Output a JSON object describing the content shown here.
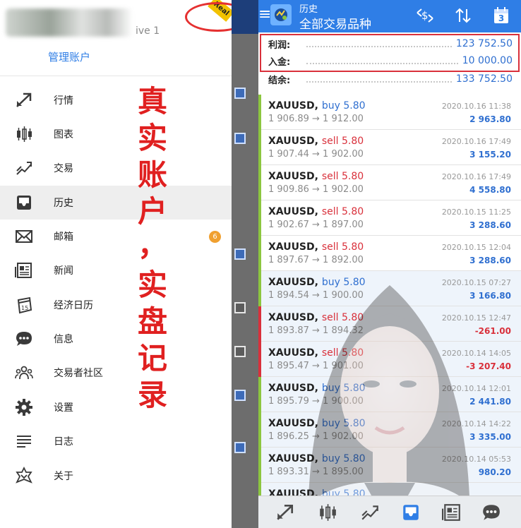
{
  "drawer": {
    "account_name": "",
    "account_status": "ive 1",
    "manage_accounts": "管理账户",
    "real_badge": "Real",
    "items": [
      {
        "label": "行情",
        "icon": "quotes-icon"
      },
      {
        "label": "图表",
        "icon": "candlestick-chart-icon"
      },
      {
        "label": "交易",
        "icon": "trade-icon"
      },
      {
        "label": "历史",
        "icon": "history-inbox-icon"
      },
      {
        "label": "邮箱",
        "icon": "mail-icon",
        "badge": "6"
      },
      {
        "label": "新闻",
        "icon": "news-icon"
      },
      {
        "label": "经济日历",
        "icon": "economic-calendar-icon"
      },
      {
        "label": "信息",
        "icon": "chat-bubble-icon"
      },
      {
        "label": "交易者社区",
        "icon": "community-icon"
      },
      {
        "label": "设置",
        "icon": "gear-icon"
      },
      {
        "label": "日志",
        "icon": "journal-icon"
      },
      {
        "label": "关于",
        "icon": "about-icon"
      }
    ],
    "active_index": 3,
    "overlay_text": [
      "真",
      "实",
      "账",
      "户",
      "，",
      "实",
      "盘",
      "记",
      "录"
    ]
  },
  "appbar": {
    "title": "历史",
    "subtitle": "全部交易品种",
    "menu_icon": "hamburger-icon",
    "actions": [
      "currency-exchange-icon",
      "sort-icon",
      "calendar-icon"
    ],
    "calendar_day": "3"
  },
  "summary": {
    "profit_label": "利润:",
    "profit_value": "123 752.50",
    "deposit_label": "入金:",
    "deposit_value": "10 000.00",
    "balance_label": "结余:",
    "balance_value": "133 752.50"
  },
  "deals": [
    {
      "symbol": "XAUUSD,",
      "side": "buy 5.80",
      "prices": "1 906.89 → 1 912.00",
      "time": "2020.10.16 11:38",
      "profit": "2 963.80"
    },
    {
      "symbol": "XAUUSD,",
      "side": "sell 5.80",
      "prices": "1 907.44 → 1 902.00",
      "time": "2020.10.16 17:49",
      "profit": "3 155.20"
    },
    {
      "symbol": "XAUUSD,",
      "side": "sell 5.80",
      "prices": "1 909.86 → 1 902.00",
      "time": "2020.10.16 17:49",
      "profit": "4 558.80"
    },
    {
      "symbol": "XAUUSD,",
      "side": "sell 5.80",
      "prices": "1 902.67 → 1 897.00",
      "time": "2020.10.15 11:25",
      "profit": "3 288.60"
    },
    {
      "symbol": "XAUUSD,",
      "side": "sell 5.80",
      "prices": "1 897.67 → 1 892.00",
      "time": "2020.10.15 12:04",
      "profit": "3 288.60"
    },
    {
      "symbol": "XAUUSD,",
      "side": "buy 5.80",
      "prices": "1 894.54 → 1 900.00",
      "time": "2020.10.15 07:27",
      "profit": "3 166.80"
    },
    {
      "symbol": "XAUUSD,",
      "side": "sell 5.80",
      "prices": "1 893.87 → 1 894.32",
      "time": "2020.10.15 12:47",
      "profit": "-261.00"
    },
    {
      "symbol": "XAUUSD,",
      "side": "sell 5.80",
      "prices": "1 895.47 → 1 901.00",
      "time": "2020.10.14 14:05",
      "profit": "-3 207.40"
    },
    {
      "symbol": "XAUUSD,",
      "side": "buy 5.80",
      "prices": "1 895.79 → 1 900.00",
      "time": "2020.10.14 12:01",
      "profit": "2 441.80"
    },
    {
      "symbol": "XAUUSD,",
      "side": "buy 5.80",
      "prices": "1 896.25 → 1 902.00",
      "time": "2020.10.14 14:22",
      "profit": "3 335.00"
    },
    {
      "symbol": "XAUUSD,",
      "side": "buy 5.80",
      "prices": "1 893.31 → 1 895.00",
      "time": "2020.10.14 05:53",
      "profit": "980.20"
    },
    {
      "symbol": "XAUUSD,",
      "side": "buy 5.80",
      "prices": "",
      "time": "",
      "profit": ""
    }
  ],
  "bottom_nav": [
    "quotes-icon",
    "candlestick-chart-icon",
    "trade-icon",
    "history-inbox-icon",
    "news-icon",
    "chat-bubble-icon"
  ],
  "colors": {
    "primary": "#2f7ee6",
    "buy": "#2f6fd0",
    "sell": "#d9303b",
    "profit_positive": "#2f6fd0",
    "profit_negative": "#d9303b",
    "bar_positive": "#8cc63f",
    "bar_negative": "#d9303b",
    "annotation": "#e02020"
  }
}
